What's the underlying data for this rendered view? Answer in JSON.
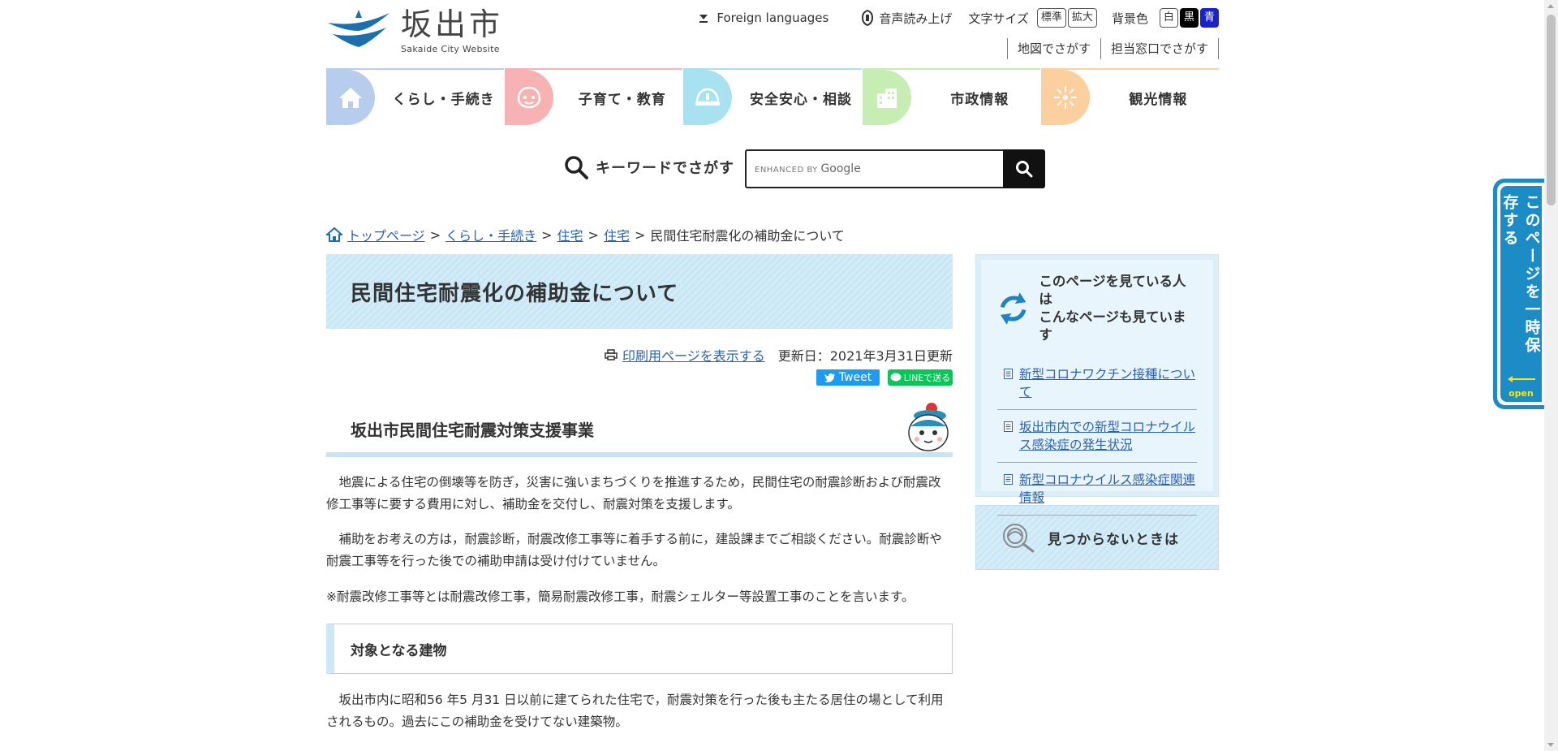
{
  "site": {
    "title": "坂出市",
    "subtitle": "Sakaide City Website"
  },
  "utility": {
    "languages": "Foreign languages",
    "voice": "音声読み上げ",
    "font_size_label": "文字サイズ",
    "font_standard": "標準",
    "font_large": "拡大",
    "bg_label": "背景色",
    "bg_white": "白",
    "bg_black": "黒",
    "bg_blue": "青",
    "map_search": "地図でさがす",
    "office_search": "担当窓口でさがす"
  },
  "nav": {
    "items": [
      {
        "label": "くらし・手続き",
        "color": "#b7cdee",
        "icon": "house-icon"
      },
      {
        "label": "子育て・教育",
        "color": "#f7b3b3",
        "icon": "child-icon"
      },
      {
        "label": "安全安心・相談",
        "color": "#a8e2f1",
        "icon": "helmet-icon"
      },
      {
        "label": "市政情報",
        "color": "#c6edb3",
        "icon": "building-icon"
      },
      {
        "label": "観光情報",
        "color": "#fccf9e",
        "icon": "firework-icon"
      }
    ]
  },
  "search": {
    "label": "キーワードでさがす",
    "enhanced_by": "ENHANCED BY",
    "google": "Google"
  },
  "breadcrumb": {
    "home": "トップページ",
    "c1": "くらし・手続き",
    "c2": "住宅",
    "c3": "住宅",
    "current": "民間住宅耐震化の補助金について",
    "sep": ">"
  },
  "page": {
    "title": "民間住宅耐震化の補助金について",
    "print_link": "印刷用ページを表示する",
    "updated": "更新日：2021年3月31日更新",
    "tweet": "Tweet",
    "line": "LINEで送る",
    "section_title": "坂出市民間住宅耐震対策支援事業",
    "para1": "地震による住宅の倒壊等を防ぎ，災害に強いまちづくりを推進するため，民間住宅の耐震診断および耐震改修工事等に要する費用に対し、補助金を交付し、耐震対策を支援します。",
    "para2": "補助をお考えの方は，耐震診断，耐震改修工事等に着手する前に，建設課までご相談ください。耐震診断や耐震工事等を行った後での補助申請は受け付けていません。",
    "para3": "※耐震改修工事等とは耐震改修工事，簡易耐震改修工事，耐震シェルター等設置工事のことを言います。",
    "subsection_title": "対象となる建物",
    "para4": "坂出市内に昭和56 年5 月31 日以前に建てられた住宅で，耐震対策を行った後も主たる居住の場として利用されるもの。過去にこの補助金を受けてない建築物。"
  },
  "sidebar": {
    "heading_line1": "このページを見ている人は",
    "heading_line2": "こんなページも見ています",
    "links": [
      {
        "text": "新型コロナワクチン接種について"
      },
      {
        "text": "坂出市内での新型コロナウイルス感染症の発生状況"
      },
      {
        "text": "新型コロナウイルス感染症関連情報"
      }
    ],
    "not_found": "見つからないときは"
  },
  "save_tab": {
    "text": "このページを一時保存する",
    "open": "open"
  }
}
